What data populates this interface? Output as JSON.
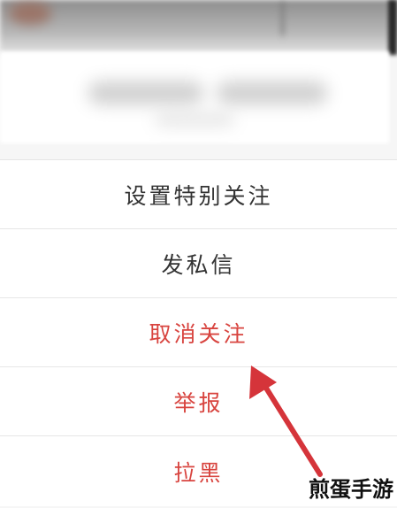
{
  "menu": {
    "items": [
      {
        "label": "设置特别关注",
        "color": "#333333"
      },
      {
        "label": "发私信",
        "color": "#333333"
      },
      {
        "label": "取消关注",
        "color": "#d8443f"
      },
      {
        "label": "举报",
        "color": "#d8443f"
      },
      {
        "label": "拉黑",
        "color": "#d8443f"
      }
    ]
  },
  "annotation": {
    "arrow_color": "#d5343a",
    "arrow_target": "取消关注"
  },
  "watermark": {
    "text": "煎蛋手游"
  }
}
